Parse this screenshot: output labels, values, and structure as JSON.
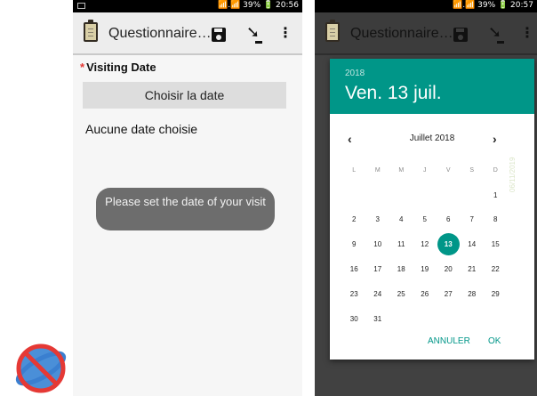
{
  "left_screen": {
    "status_bar": {
      "right": "📶.📶 39% 🔋 20:56"
    },
    "toolbar": {
      "title": "Questionnaire…"
    },
    "question": {
      "required_marker": "*",
      "label": "Visiting Date"
    },
    "choose_date_button": "Choisir la date",
    "no_date_text": "Aucune date choisie",
    "toast": "Please set the date of your visit"
  },
  "right_screen": {
    "status_bar": {
      "right": "📶.📶 39% 🔋 20:57"
    },
    "toolbar": {
      "title": "Questionnaire…"
    },
    "dialog": {
      "year": "2018",
      "selected_date": "Ven. 13 juil.",
      "month_label": "Juillet 2018",
      "prev": "‹",
      "next": "›",
      "watermark": "06/11/2019",
      "weekday_headers": [
        "L",
        "M",
        "M",
        "J",
        "V",
        "S",
        "D"
      ],
      "weeks": [
        [
          "",
          "",
          "",
          "",
          "",
          "",
          "1"
        ],
        [
          "2",
          "3",
          "4",
          "5",
          "6",
          "7",
          "8"
        ],
        [
          "9",
          "10",
          "11",
          "12",
          "13",
          "14",
          "15"
        ],
        [
          "16",
          "17",
          "18",
          "19",
          "20",
          "21",
          "22"
        ],
        [
          "23",
          "24",
          "25",
          "26",
          "27",
          "28",
          "29"
        ],
        [
          "30",
          "31",
          "",
          "",
          "",
          "",
          ""
        ]
      ],
      "selected_day": "13",
      "cancel": "ANNULER",
      "ok": "OK"
    }
  },
  "colors": {
    "accent": "#009688",
    "required": "#e53935",
    "toast_bg": "#6d6d6d",
    "dim_overlay": "#414141"
  },
  "icons": {
    "clipboard": "clipboard-icon",
    "save": "save-icon",
    "send": "download-arrow-icon",
    "overflow": "overflow-menu-icon",
    "badge": "no-browser-icon"
  }
}
